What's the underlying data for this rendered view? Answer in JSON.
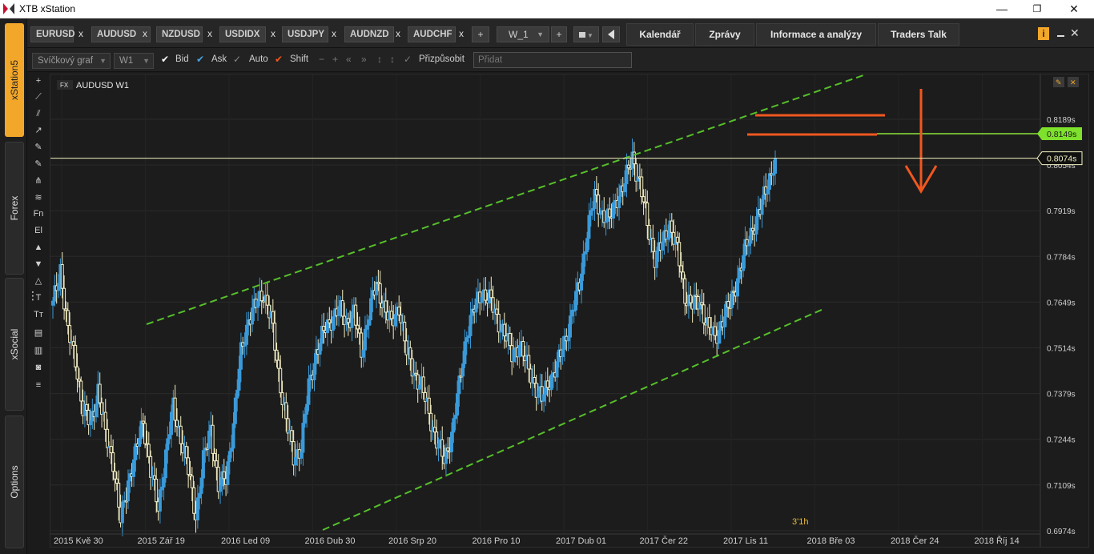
{
  "window": {
    "title": "XTB xStation",
    "minimize": "—",
    "maximize": "❐",
    "close": "✕"
  },
  "rail_tabs": [
    "xStation5",
    "Forex",
    "xSocial",
    "Options"
  ],
  "symbol_tabs": [
    "EURUSD",
    "AUDUSD",
    "NZDUSD",
    "USDIDX",
    "USDJPY",
    "AUDNZD",
    "AUDCHF"
  ],
  "tab_close": "x",
  "add_tab": "+",
  "workspace": {
    "label": "W_1",
    "add": "+"
  },
  "nav_tabs": [
    "Kalendář",
    "Zprávy",
    "Informace a analýzy",
    "Traders Talk"
  ],
  "toolbar": {
    "chart_type": "Svíčkový graf",
    "timeframe": "W1",
    "bid": "Bid",
    "ask": "Ask",
    "auto": "Auto",
    "shift": "Shift",
    "customize": "Přizpůsobit",
    "add_placeholder": "Přidat"
  },
  "draw_tools": [
    "+",
    "Fn",
    "El",
    "T",
    "Tт"
  ],
  "chart": {
    "badge": "FX",
    "symbol_label": "AUDUSD W1",
    "candle_timer": "3'1h",
    "current_price": "0.8074s",
    "line_price": "0.8149s",
    "colors": {
      "bull": "#3a9ad9",
      "bear": "#f5efc4",
      "channel": "#56c02b",
      "arrow": "#f0571f",
      "line": "#8be33a",
      "price": "#f4f2c2"
    }
  },
  "chart_data": {
    "type": "candlestick",
    "symbol": "AUDUSD",
    "timeframe": "W1",
    "y_ticks": [
      "0.8189s",
      "0.8054s",
      "0.7919s",
      "0.7784s",
      "0.7649s",
      "0.7514s",
      "0.7379s",
      "0.7244s",
      "0.7109s",
      "0.6974s"
    ],
    "x_ticks": [
      "2015 Kvě 30",
      "2015 Zář 19",
      "2016 Led 09",
      "2016 Dub 30",
      "2016 Srp 20",
      "2016 Pro 10",
      "2017 Dub 01",
      "2017 Čer 22",
      "2017 Lis 11",
      "2018 Bře 03",
      "2018 Čer 24",
      "2018 Říj 14"
    ],
    "ylim": [
      0.6974,
      0.8189
    ],
    "current_price": 0.8074,
    "horizontal_line": 0.8149,
    "close_path": [
      [
        0,
        0.764
      ],
      [
        4,
        0.775
      ],
      [
        8,
        0.756
      ],
      [
        12,
        0.748
      ],
      [
        16,
        0.733
      ],
      [
        20,
        0.729
      ],
      [
        24,
        0.739
      ],
      [
        28,
        0.726
      ],
      [
        32,
        0.718
      ],
      [
        36,
        0.7
      ],
      [
        40,
        0.712
      ],
      [
        44,
        0.72
      ],
      [
        48,
        0.73
      ],
      [
        52,
        0.715
      ],
      [
        56,
        0.704
      ],
      [
        60,
        0.72
      ],
      [
        64,
        0.734
      ],
      [
        68,
        0.725
      ],
      [
        72,
        0.715
      ],
      [
        76,
        0.702
      ],
      [
        80,
        0.718
      ],
      [
        84,
        0.728
      ],
      [
        88,
        0.71
      ],
      [
        92,
        0.713
      ],
      [
        96,
        0.729
      ],
      [
        100,
        0.75
      ],
      [
        104,
        0.76
      ],
      [
        108,
        0.764
      ],
      [
        112,
        0.768
      ],
      [
        116,
        0.76
      ],
      [
        120,
        0.744
      ],
      [
        124,
        0.73
      ],
      [
        128,
        0.719
      ],
      [
        132,
        0.722
      ],
      [
        136,
        0.74
      ],
      [
        140,
        0.75
      ],
      [
        144,
        0.756
      ],
      [
        148,
        0.76
      ],
      [
        152,
        0.763
      ],
      [
        156,
        0.759
      ],
      [
        160,
        0.762
      ],
      [
        164,
        0.75
      ],
      [
        168,
        0.762
      ],
      [
        172,
        0.77
      ],
      [
        176,
        0.764
      ],
      [
        180,
        0.758
      ],
      [
        184,
        0.764
      ],
      [
        188,
        0.75
      ],
      [
        192,
        0.744
      ],
      [
        196,
        0.74
      ],
      [
        200,
        0.732
      ],
      [
        204,
        0.724
      ],
      [
        208,
        0.718
      ],
      [
        212,
        0.726
      ],
      [
        216,
        0.74
      ],
      [
        220,
        0.756
      ],
      [
        224,
        0.763
      ],
      [
        228,
        0.768
      ],
      [
        232,
        0.766
      ],
      [
        236,
        0.76
      ],
      [
        240,
        0.756
      ],
      [
        244,
        0.749
      ],
      [
        248,
        0.753
      ],
      [
        252,
        0.746
      ],
      [
        256,
        0.741
      ],
      [
        260,
        0.736
      ],
      [
        264,
        0.742
      ],
      [
        268,
        0.746
      ],
      [
        272,
        0.753
      ],
      [
        276,
        0.762
      ],
      [
        280,
        0.77
      ],
      [
        284,
        0.786
      ],
      [
        288,
        0.796
      ],
      [
        292,
        0.791
      ],
      [
        296,
        0.789
      ],
      [
        300,
        0.796
      ],
      [
        304,
        0.8
      ],
      [
        308,
        0.808
      ],
      [
        312,
        0.8
      ],
      [
        316,
        0.788
      ],
      [
        320,
        0.778
      ],
      [
        324,
        0.782
      ],
      [
        328,
        0.788
      ],
      [
        332,
        0.78
      ],
      [
        336,
        0.767
      ],
      [
        340,
        0.764
      ],
      [
        344,
        0.765
      ],
      [
        348,
        0.758
      ],
      [
        352,
        0.754
      ],
      [
        356,
        0.76
      ],
      [
        360,
        0.764
      ],
      [
        364,
        0.772
      ],
      [
        368,
        0.78
      ],
      [
        372,
        0.787
      ],
      [
        376,
        0.792
      ],
      [
        380,
        0.8
      ],
      [
        384,
        0.8074
      ]
    ]
  }
}
